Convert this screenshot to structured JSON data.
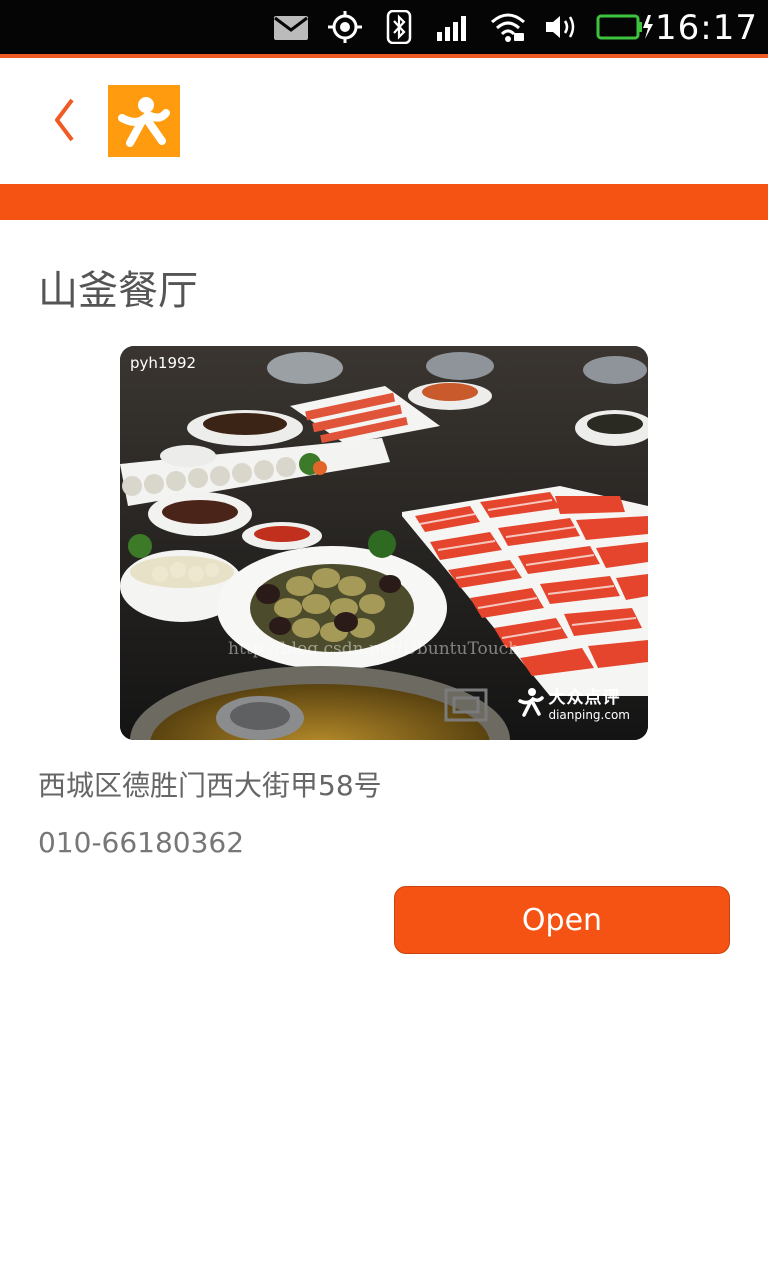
{
  "status_bar": {
    "time": "16:17",
    "icons": [
      "mail-icon",
      "location-icon",
      "bluetooth-icon",
      "signal-icon",
      "wifi-icon",
      "volume-icon",
      "battery-icon"
    ],
    "battery_color": "#3ec33e"
  },
  "header": {
    "back_icon": "chevron-left-icon",
    "logo": "dianping-logo",
    "accent": "#f55313",
    "logo_color": "#ff9b0f"
  },
  "restaurant": {
    "name": "山釜餐厅",
    "address": "西城区德胜门西大街甲58号",
    "phone": "010-66180362"
  },
  "photo": {
    "credit": "pyh1992",
    "watermark_url": "http://blog.csdn.net/UbuntuTouch",
    "brand_cn": "大众点评",
    "brand_en": "dianping.com"
  },
  "actions": {
    "open_label": "Open"
  }
}
